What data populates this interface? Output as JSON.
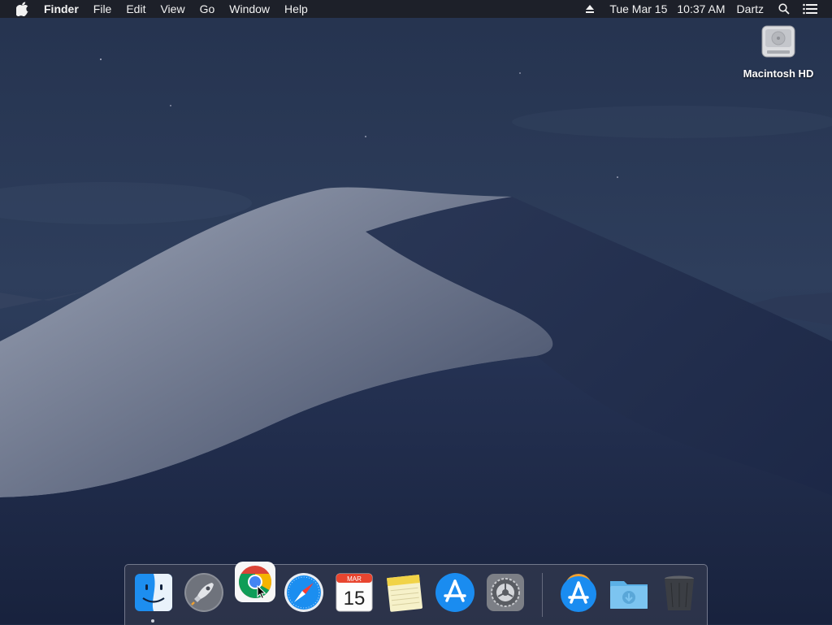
{
  "menubar": {
    "apple_icon": "apple-logo-icon",
    "app_name": "Finder",
    "menus": [
      "File",
      "Edit",
      "View",
      "Go",
      "Window",
      "Help"
    ],
    "status": {
      "eject_icon": "eject-icon",
      "date": "Tue Mar 15",
      "time": "10:37 AM",
      "user": "Dartz",
      "spotlight_icon": "spotlight-search-icon",
      "notification_icon": "notification-center-icon"
    }
  },
  "desktop": {
    "icons": [
      {
        "label": "Macintosh HD",
        "icon": "hard-drive-icon"
      }
    ]
  },
  "dock": {
    "items": [
      {
        "name": "Finder",
        "icon": "finder-icon",
        "running": true
      },
      {
        "name": "Launchpad",
        "icon": "launchpad-rocket-icon"
      },
      {
        "name": "Google Chrome",
        "icon": "chrome-icon"
      },
      {
        "name": "Safari",
        "icon": "safari-compass-icon"
      },
      {
        "name": "Calendar",
        "icon": "calendar-icon",
        "month": "MAR",
        "day": "15"
      },
      {
        "name": "Notes",
        "icon": "notes-icon"
      },
      {
        "name": "App Store",
        "icon": "app-store-icon"
      },
      {
        "name": "System Preferences",
        "icon": "system-preferences-gear-icon"
      },
      {
        "name": "Applications",
        "icon": "applications-stack-icon"
      },
      {
        "name": "Downloads",
        "icon": "downloads-folder-icon"
      },
      {
        "name": "Trash",
        "icon": "trash-icon"
      }
    ]
  },
  "colors": {
    "menubar": "#1c1e26",
    "sky": "#1d2a45",
    "dune_light": "#8c94a8",
    "dune_dark": "#202c4a"
  }
}
